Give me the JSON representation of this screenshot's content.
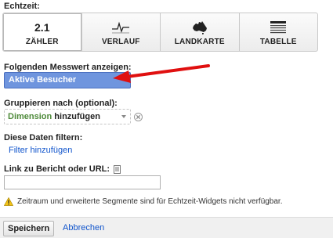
{
  "realtime": {
    "label": "Echtzeit:",
    "options": [
      {
        "icon_text": "2.1",
        "label": "ZÄHLER",
        "active": true
      },
      {
        "icon": "sparkline-icon",
        "label": "VERLAUF",
        "active": false
      },
      {
        "icon": "australia-map-icon",
        "label": "LANDKARTE",
        "active": false
      },
      {
        "icon": "table-icon",
        "label": "TABELLE",
        "active": false
      }
    ]
  },
  "metric": {
    "label": "Folgenden Messwert anzeigen:",
    "value": "Aktive Besucher"
  },
  "group": {
    "label": "Gruppieren nach (optional):",
    "dimension_word": "Dimension",
    "dimension_rest": " hinzufügen"
  },
  "filter": {
    "label": "Diese Daten filtern:",
    "link": "Filter hinzufügen"
  },
  "link_url": {
    "label": "Link zu Bericht oder URL:",
    "value": ""
  },
  "warning": {
    "text": "Zeitraum und erweiterte Segmente sind für Echtzeit-Widgets nicht verfügbar."
  },
  "footer": {
    "save": "Speichern",
    "cancel": "Abbrechen"
  },
  "colors": {
    "selected_metric_bg": "#6f95de",
    "link": "#1155cc",
    "dimension_green": "#4f8b3b",
    "arrow": "#e01010"
  }
}
